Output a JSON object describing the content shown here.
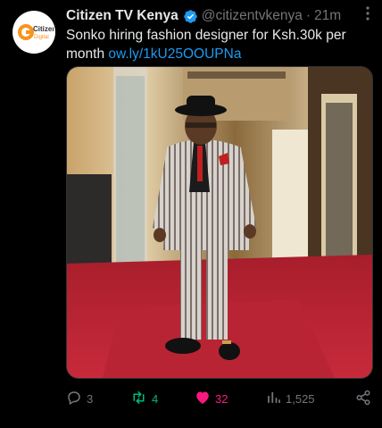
{
  "author": {
    "name": "Citizen TV Kenya",
    "handle": "@citizentvkenya",
    "separator": "·",
    "time": "21m",
    "avatar_logo_text": "Citizen Digital"
  },
  "tweet": {
    "text": "Sonko hiring fashion designer for Ksh.30k per month",
    "link": "ow.ly/1kU25OOUPNa"
  },
  "media": {
    "description_icon": "photo"
  },
  "actions": {
    "replies": "3",
    "retweets": "4",
    "likes": "32",
    "views": "1,525"
  },
  "icons": {
    "verified": "verified-badge-icon",
    "more": "more-icon",
    "reply": "reply-icon",
    "retweet": "retweet-icon",
    "like": "heart-icon",
    "views": "views-icon",
    "share": "share-icon"
  },
  "colors": {
    "background": "#000000",
    "text": "#e7e9ea",
    "muted": "#71767b",
    "link": "#1d9bf0",
    "retweet": "#00ba7c",
    "like": "#f91880"
  }
}
